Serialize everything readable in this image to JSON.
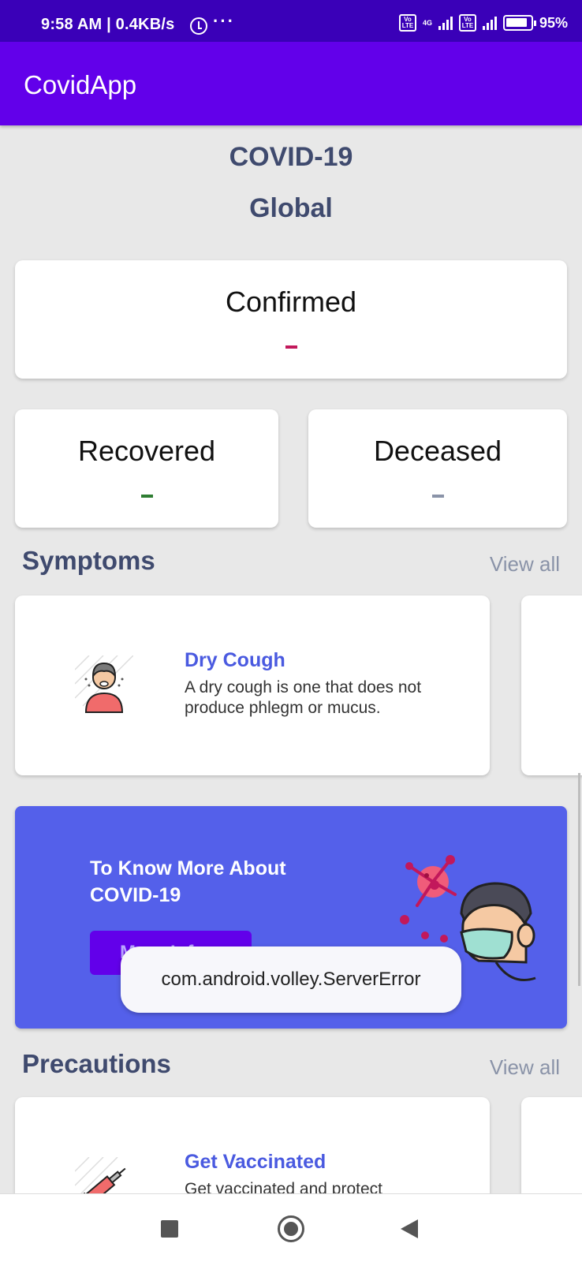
{
  "status_bar": {
    "time": "9:58 AM | 0.4KB/s",
    "network": "4G",
    "battery": "95%"
  },
  "app_bar": {
    "title": "CovidApp"
  },
  "header": {
    "title": "COVID-19",
    "subtitle": "Global"
  },
  "stats": {
    "confirmed": {
      "label": "Confirmed",
      "value": "-",
      "color": "#c2185b"
    },
    "recovered": {
      "label": "Recovered",
      "value": "-",
      "color": "#2e7d32"
    },
    "deceased": {
      "label": "Deceased",
      "value": "-",
      "color": "#8a93a8"
    }
  },
  "symptoms": {
    "title": "Symptoms",
    "view_all": "View all",
    "items": [
      {
        "title": "Dry Cough",
        "description": "A dry cough is one that does not produce phlegm or mucus.",
        "icon": "coughing-person-icon"
      }
    ]
  },
  "banner": {
    "text": "To Know More About COVID-19",
    "button": "More Info",
    "illustration": "virus-masked-person-icon"
  },
  "toast": {
    "message": "com.android.volley.ServerError"
  },
  "precautions": {
    "title": "Precautions",
    "view_all": "View all",
    "items": [
      {
        "title": "Get Vaccinated",
        "description": "Get vaccinated and protect",
        "icon": "syringe-icon"
      }
    ]
  },
  "colors": {
    "app_bar": "#6200ea",
    "status_bar": "#3a00b8",
    "accent_text": "#3f4a6e",
    "banner": "#5460ea"
  }
}
